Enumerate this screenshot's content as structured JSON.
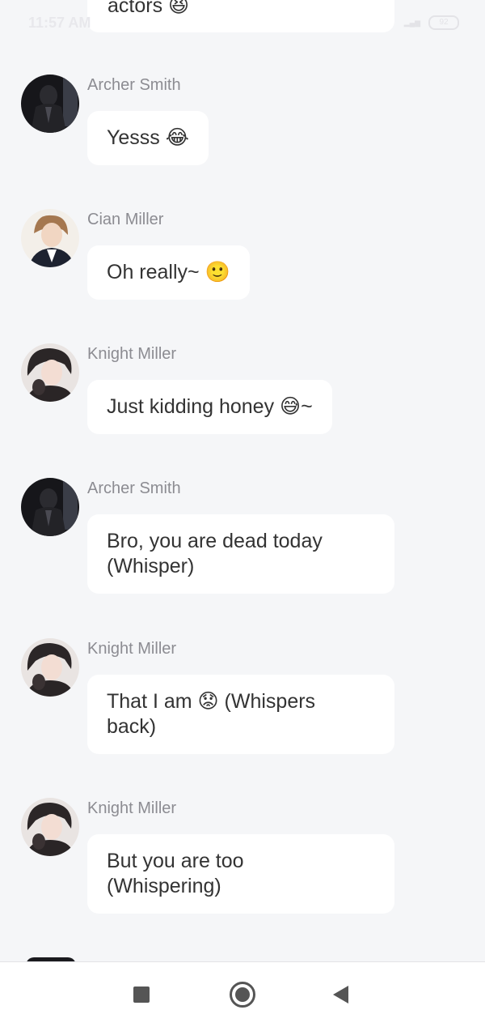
{
  "status_bar": {
    "time": "11:57 AM",
    "battery": "92"
  },
  "chat": {
    "previous_message_tail": "actors 😆",
    "messages": [
      {
        "sender": "Archer Smith",
        "text": "Yesss 😂",
        "avatar": "archer-avatar"
      },
      {
        "sender": "Cian Miller",
        "text": "Oh really~ 🙂",
        "avatar": "cian-avatar"
      },
      {
        "sender": "Knight Miller",
        "text": "Just kidding honey 😅~",
        "avatar": "knight-avatar"
      },
      {
        "sender": "Archer Smith",
        "text": "Bro, you are dead today\n(Whisper)",
        "avatar": "archer-avatar"
      },
      {
        "sender": "Knight Miller",
        "text": "That I am 😟 (Whispers\nback)",
        "avatar": "knight-avatar"
      },
      {
        "sender": "Knight Miller",
        "text": "But you are too\n(Whispering)",
        "avatar": "knight-avatar"
      }
    ]
  },
  "nav_bar": {
    "recents_icon": "square-icon",
    "home_icon": "circle-icon",
    "back_icon": "triangle-back-icon"
  }
}
